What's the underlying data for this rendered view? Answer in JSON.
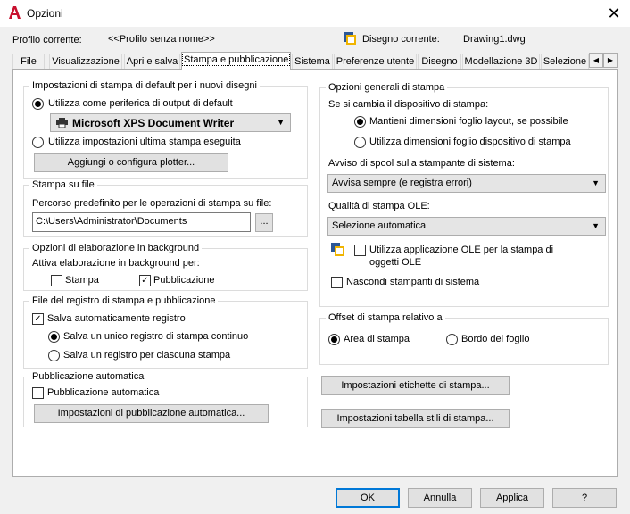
{
  "window": {
    "title": "Opzioni",
    "close_glyph": "✕"
  },
  "header": {
    "profile_label": "Profilo corrente:",
    "profile_value": "<<Profilo senza nome>>",
    "drawing_label": "Disegno corrente:",
    "drawing_value": "Drawing1.dwg"
  },
  "tabs": [
    {
      "label": "File"
    },
    {
      "label": "Visualizzazione"
    },
    {
      "label": "Apri e salva"
    },
    {
      "label": "Stampa e pubblicazione",
      "active": true
    },
    {
      "label": "Sistema"
    },
    {
      "label": "Preferenze utente"
    },
    {
      "label": "Disegno"
    },
    {
      "label": "Modellazione 3D"
    },
    {
      "label": "Selezione"
    }
  ],
  "left": {
    "default_print": {
      "title": "Impostazioni di stampa di default per i nuovi disegni",
      "use_device_label": "Utilizza come periferica di output di default",
      "device_value": "Microsoft XPS Document Writer",
      "use_last_label": "Utilizza impostazioni ultima stampa eseguita",
      "add_plotter_button": "Aggiungi o configura plotter..."
    },
    "print_to_file": {
      "title": "Stampa su file",
      "path_label": "Percorso predefinito per le operazioni di stampa su file:",
      "path_value": "C:\\Users\\Administrator\\Documents",
      "browse_button": "..."
    },
    "background": {
      "title": "Opzioni di elaborazione in background",
      "enable_label": "Attiva elaborazione in background per:",
      "print_label": "Stampa",
      "publish_label": "Pubblicazione"
    },
    "log": {
      "title": "File del registro di stampa e pubblicazione",
      "auto_save_label": "Salva automaticamente registro",
      "single_log_label": "Salva un unico registro di stampa continuo",
      "per_print_label": "Salva un registro per ciascuna stampa"
    },
    "auto_publish": {
      "title": "Pubblicazione automatica",
      "auto_publish_label": "Pubblicazione automatica",
      "settings_button": "Impostazioni di pubblicazione automatica..."
    }
  },
  "right": {
    "general": {
      "title": "Opzioni generali di stampa",
      "change_device_label": "Se si cambia il dispositivo di stampa:",
      "keep_layout_label": "Mantieni dimensioni foglio layout, se possibile",
      "use_device_size_label": "Utilizza dimensioni foglio dispositivo di stampa",
      "spool_label": "Avviso di spool sulla stampante di sistema:",
      "spool_value": "Avvisa sempre (e registra errori)",
      "ole_quality_label": "Qualità di stampa OLE:",
      "ole_quality_value": "Selezione automatica",
      "ole_app_label_line1": "Utilizza applicazione OLE per la stampa di",
      "ole_app_label_line2": "oggetti OLE",
      "hide_printers_label": "Nascondi stampanti di sistema"
    },
    "offset": {
      "title": "Offset di stampa relativo a",
      "print_area_label": "Area di stampa",
      "paper_edge_label": "Bordo del foglio"
    },
    "stamp_button": "Impostazioni etichette di stampa...",
    "style_table_button": "Impostazioni tabella stili di stampa..."
  },
  "footer": {
    "ok": "OK",
    "cancel": "Annulla",
    "apply": "Applica",
    "help": "?"
  },
  "colors": {
    "accent": "#0078d7",
    "brand_red": "#c8102e"
  }
}
